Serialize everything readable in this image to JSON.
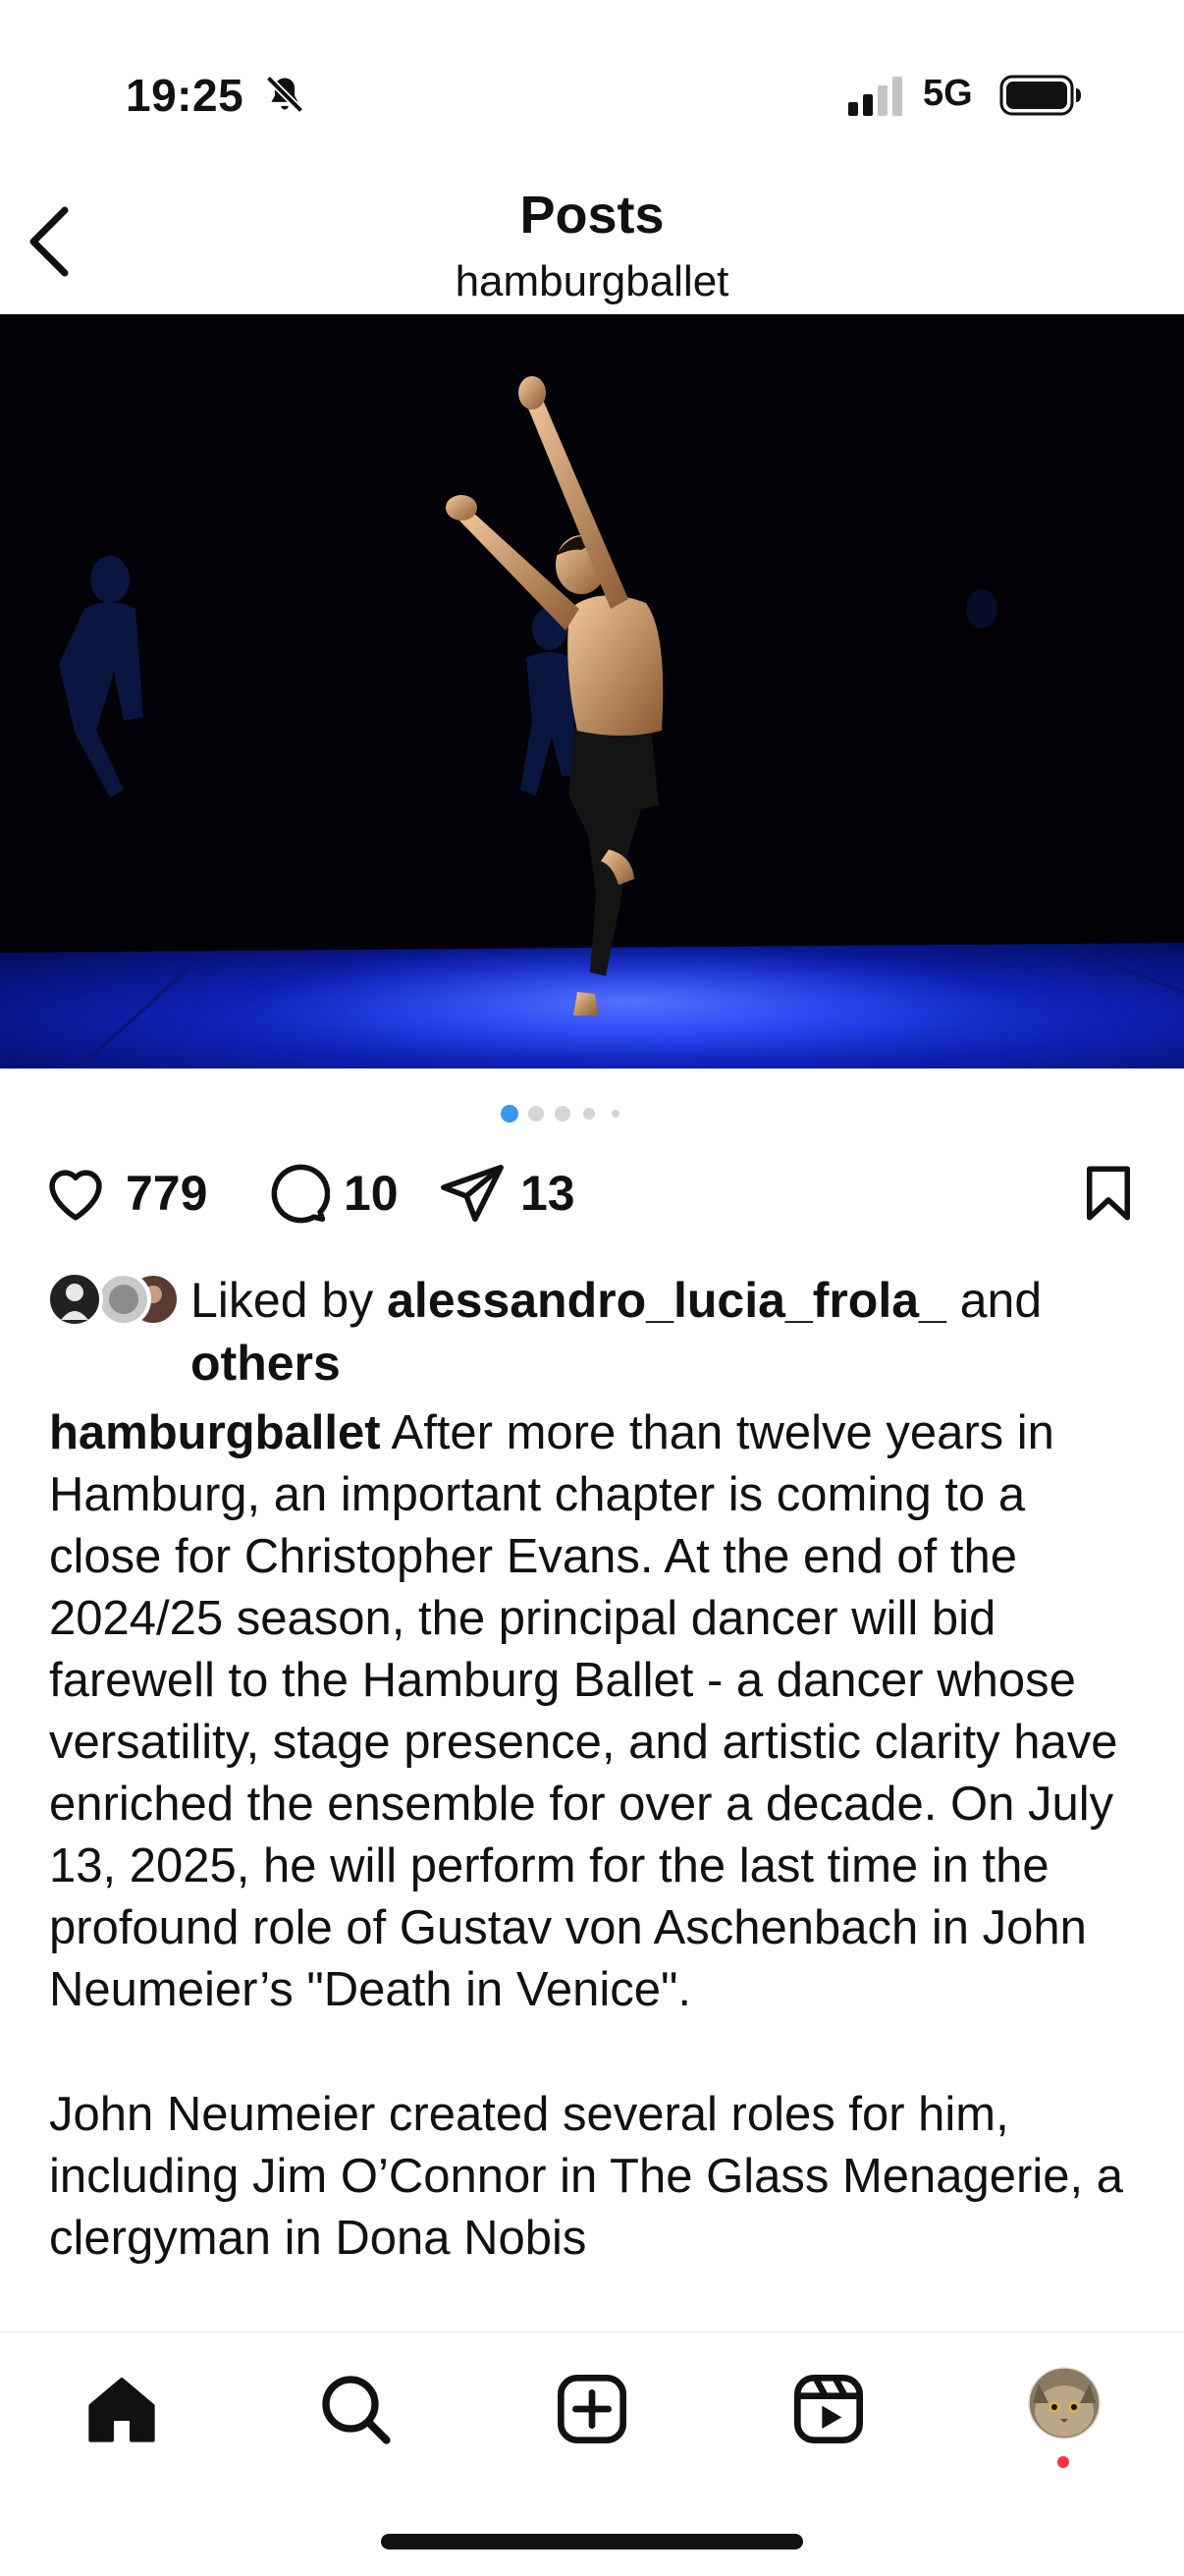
{
  "status": {
    "time": "19:25",
    "network": "5G"
  },
  "header": {
    "title": "Posts",
    "account": "hamburgballet"
  },
  "carousel": {
    "total": 5,
    "active": 1
  },
  "actions": {
    "likes": "779",
    "comments": "10",
    "shares": "13"
  },
  "liked_by": {
    "prefix": "Liked by ",
    "user": "alessandro_lucia_frola_",
    "middle": " and ",
    "others": "others"
  },
  "caption": {
    "username": "hamburgballet",
    "paragraph1": "After more than twelve years in Hamburg, an important chapter is coming to a close for Christopher Evans. At the end of the 2024/25 season, the principal dancer will bid farewell to the Hamburg Ballet - a dancer whose versatility, stage presence, and artistic clarity have enriched the ensemble for over a decade. On July 13, 2025, he will perform for the last time in the profound role of Gustav von Aschenbach in John Neumeier’s \"Death in Venice\".",
    "paragraph2": "John Neumeier created several roles for him, including Jim O’Connor in The Glass Menagerie, a clergyman in Dona Nobis"
  },
  "colors": {
    "accent_blue": "#3897f0",
    "notification_red": "#ff3040",
    "text": "#111111"
  },
  "icons": [
    "back-chevron-icon",
    "bell-off-icon",
    "signal-icon",
    "battery-icon",
    "heart-icon",
    "comment-icon",
    "share-icon",
    "bookmark-icon",
    "home-icon",
    "search-icon",
    "create-icon",
    "reels-icon",
    "profile-avatar"
  ]
}
